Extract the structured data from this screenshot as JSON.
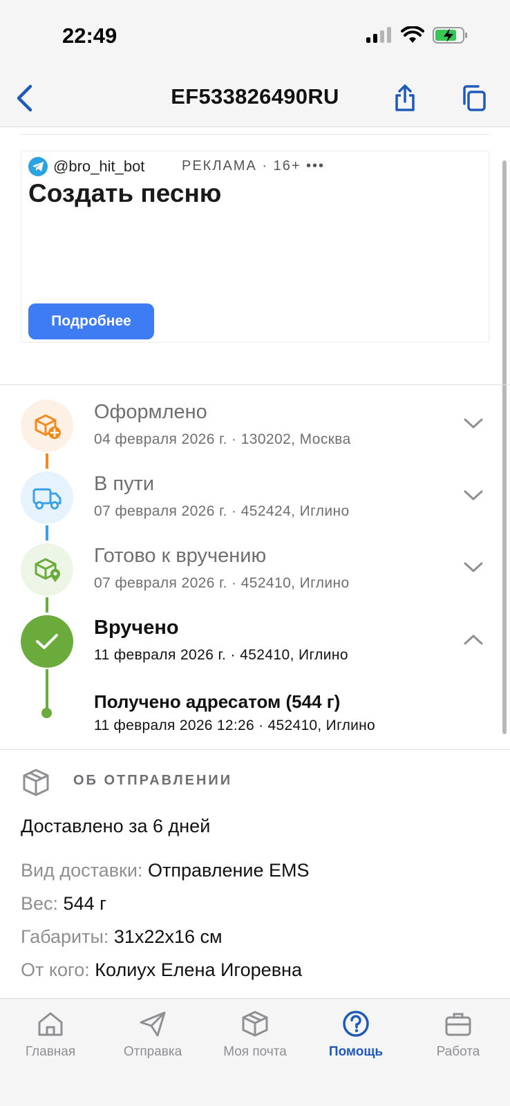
{
  "status_bar": {
    "time": "22:49"
  },
  "header": {
    "title": "EF533826490RU"
  },
  "ad": {
    "handle": "@bro_hit_bot",
    "label": "РЕКЛАМА · 16+ •••",
    "title": "Создать песню",
    "button": "Подробнее"
  },
  "timeline": [
    {
      "title": "Оформлено",
      "subtitle": "04 февраля 2026 г. · 130202, Москва",
      "color": "#f28a1e"
    },
    {
      "title": "В пути",
      "subtitle": "07 февраля 2026 г. · 452424, Иглино",
      "color": "#3aa0e8"
    },
    {
      "title": "Готово к вручению",
      "subtitle": "07 февраля 2026 г. · 452410, Иглино",
      "color": "#6aab3c"
    },
    {
      "title": "Вручено",
      "subtitle": "11 февраля 2026 г. · 452410, Иглино",
      "color": "#6aab3c"
    }
  ],
  "timeline_detail": {
    "title": "Получено адресатом (544 г)",
    "subtitle": "11 февраля 2026 12:26 · 452410, Иглино"
  },
  "about": {
    "title": "ОБ ОТПРАВЛЕНИИ",
    "summary": "Доставлено за 6 дней",
    "rows": [
      {
        "key": "Вид доставки:",
        "value": "Отправление EMS"
      },
      {
        "key": "Вес:",
        "value": "544 г"
      },
      {
        "key": "Габариты:",
        "value": "31x22x16 см"
      },
      {
        "key": "От кого:",
        "value": "Колиух Елена Игоревна"
      }
    ]
  },
  "tabs": [
    {
      "label": "Главная",
      "icon": "home-icon"
    },
    {
      "label": "Отправка",
      "icon": "send-icon"
    },
    {
      "label": "Моя почта",
      "icon": "box-icon"
    },
    {
      "label": "Помощь",
      "icon": "help-icon",
      "active": true
    },
    {
      "label": "Работа",
      "icon": "briefcase-icon"
    }
  ]
}
